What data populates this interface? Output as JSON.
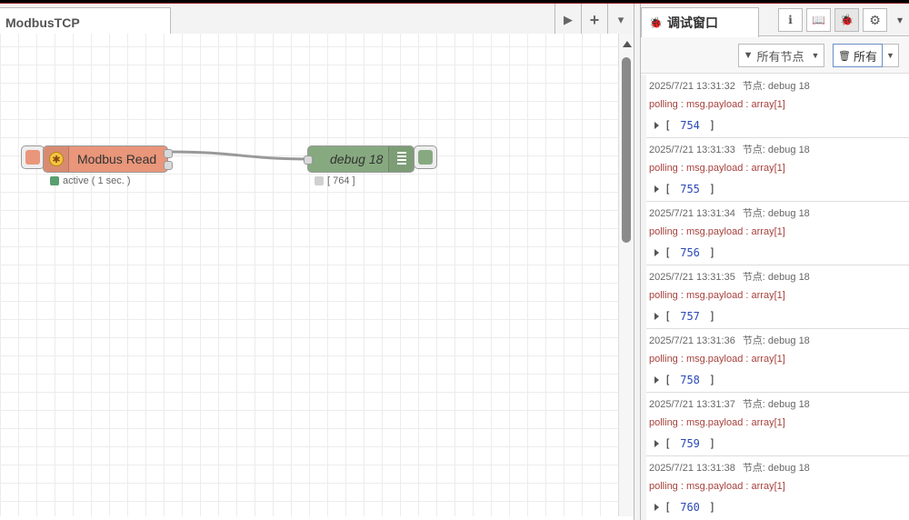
{
  "workspace": {
    "tab_title": "ModbusTCP",
    "tools": [
      {
        "name": "scroll-tabs-right-icon",
        "glyph": "▶"
      },
      {
        "name": "add-flow-icon",
        "glyph": "+"
      },
      {
        "name": "tab-menu-icon",
        "glyph": "▾"
      }
    ]
  },
  "nodes": {
    "modbus": {
      "label": "Modbus Read",
      "status": "active ( 1 sec. )",
      "color": "#e9967a",
      "status_color": "#5a9f6e"
    },
    "debug": {
      "label": "debug 18",
      "status": "[ 764 ]",
      "color": "#87a980",
      "status_color": "#d0d0d0"
    }
  },
  "sidebar": {
    "tab_title": "调试窗口",
    "icons": [
      {
        "name": "info-icon",
        "glyph": "i"
      },
      {
        "name": "help-book-icon",
        "glyph": "📖"
      },
      {
        "name": "debug-bug-icon",
        "glyph": "🐞"
      },
      {
        "name": "settings-gear-icon",
        "glyph": "⚙"
      },
      {
        "name": "sidebar-menu-icon",
        "glyph": "▾"
      }
    ],
    "filter_label": "所有节点",
    "clear_label": "所有",
    "messages": [
      {
        "time": "2025/7/21 13:31:32",
        "node": "节点: debug 18",
        "topic": "polling : msg.payload : array[1]",
        "value": "754"
      },
      {
        "time": "2025/7/21 13:31:33",
        "node": "节点: debug 18",
        "topic": "polling : msg.payload : array[1]",
        "value": "755"
      },
      {
        "time": "2025/7/21 13:31:34",
        "node": "节点: debug 18",
        "topic": "polling : msg.payload : array[1]",
        "value": "756"
      },
      {
        "time": "2025/7/21 13:31:35",
        "node": "节点: debug 18",
        "topic": "polling : msg.payload : array[1]",
        "value": "757"
      },
      {
        "time": "2025/7/21 13:31:36",
        "node": "节点: debug 18",
        "topic": "polling : msg.payload : array[1]",
        "value": "758"
      },
      {
        "time": "2025/7/21 13:31:37",
        "node": "节点: debug 18",
        "topic": "polling : msg.payload : array[1]",
        "value": "759"
      },
      {
        "time": "2025/7/21 13:31:38",
        "node": "节点: debug 18",
        "topic": "polling : msg.payload : array[1]",
        "value": "760"
      }
    ]
  }
}
